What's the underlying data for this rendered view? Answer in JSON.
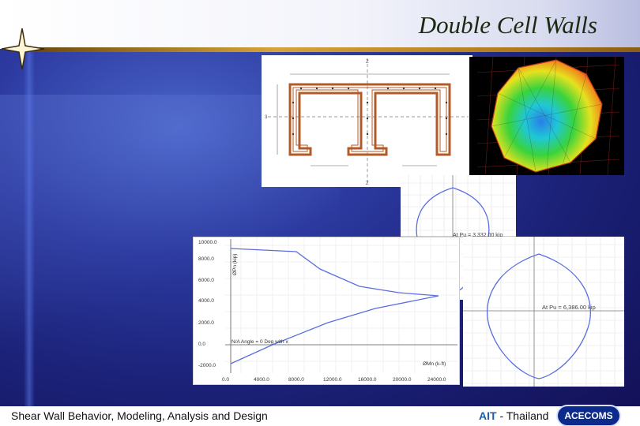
{
  "title": "Double Cell Walls",
  "footer": {
    "left_text": "Shear Wall Behavior, Modeling, Analysis and Design",
    "org_ait": "AIT",
    "org_rest": " - Thailand",
    "badge": "ACECOMS"
  },
  "section_drawing": {
    "dim_labels": [
      "Z",
      "Z",
      "3"
    ]
  },
  "curve_pu1": {
    "label": "At Pu = 3,332.00 kip"
  },
  "curve_pu2": {
    "label": "At Pu = 6,386.00 kip"
  },
  "interaction_chart": {
    "y_axis_title": "ØPn (kip)",
    "x_axis_title": "ØMn (k-ft)",
    "y_ticks": [
      "10000.0",
      "8000.0",
      "6000.0",
      "4000.0",
      "2000.0",
      "0.0",
      "-2000.0"
    ],
    "x_ticks": [
      "0.0",
      "4000.0",
      "8000.0",
      "12000.0",
      "16000.0",
      "20000.0",
      "24000.0"
    ],
    "annotation": "N/A Angle = 0 Deg with x"
  },
  "colors": {
    "background": "#1b2278",
    "title": "#1a2a10",
    "accent": "#d6a33a",
    "badge": "#0b2a8c"
  },
  "icons": [
    "compass-star-icon"
  ]
}
